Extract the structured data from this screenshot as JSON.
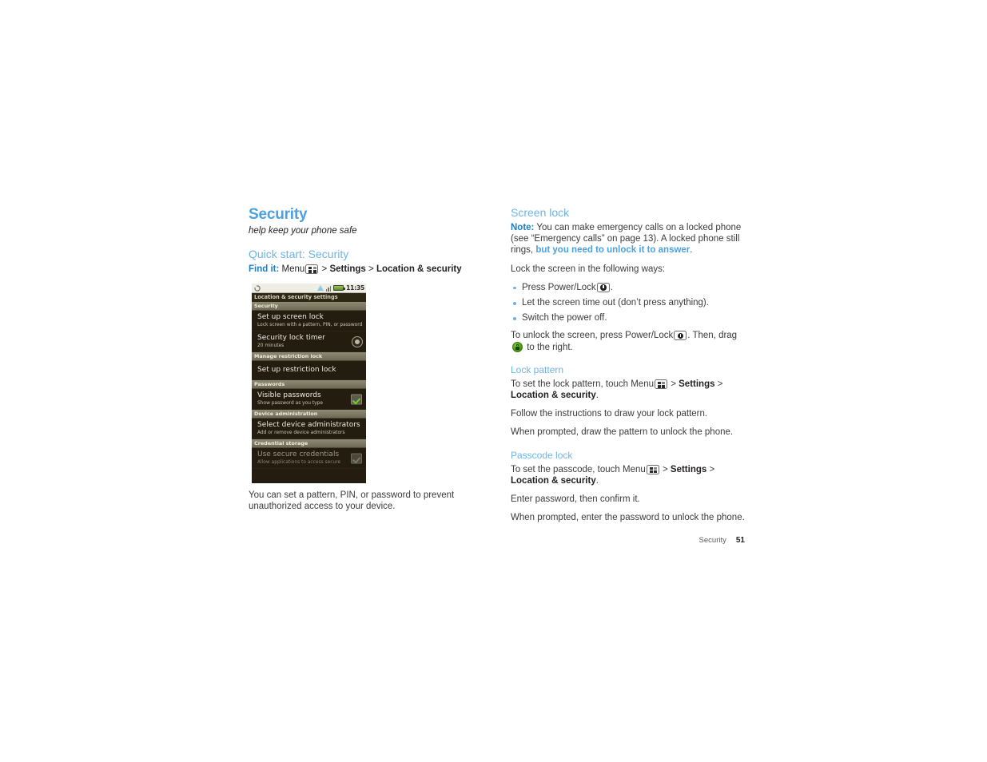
{
  "document": {
    "footer_section": "Security",
    "footer_page_number": "51"
  },
  "left_column": {
    "chapter_title": "Security",
    "chapter_subtitle": "help keep your phone safe",
    "section_heading": "Quick start: Security",
    "find_it": {
      "label": "Find it:",
      "part1": "Menu",
      "menu_icon": "menu-grid-icon",
      "sep1": ">",
      "settings": "Settings",
      "sep2": ">",
      "location_security": "Location & security"
    },
    "caption": "You can set a pattern, PIN, or password to prevent unauthorized access to your device."
  },
  "phone_screenshot": {
    "status_bar": {
      "sync_icon": "sync-icon",
      "warning_icon": "triangle-alert-icon",
      "signal_icon": "signal-bars-icon",
      "battery_icon": "battery-icon",
      "time": "11:35"
    },
    "title_bar": "Location & security settings",
    "groups": [
      {
        "category": "Security",
        "items": [
          {
            "title": "Set up screen lock",
            "subtitle": "Lock screen with a pattern, PIN, or password",
            "control": "none"
          },
          {
            "title": "Security lock timer",
            "subtitle": "20 minutes",
            "control": "timer-icon"
          }
        ]
      },
      {
        "category": "Manage restriction lock",
        "items": [
          {
            "title": "Set up restriction lock",
            "subtitle": "",
            "control": "none"
          }
        ]
      },
      {
        "category": "Passwords",
        "items": [
          {
            "title": "Visible passwords",
            "subtitle": "Show password as you type",
            "control": "checkbox-checked"
          }
        ]
      },
      {
        "category": "Device administration",
        "items": [
          {
            "title": "Select device administrators",
            "subtitle": "Add or remove device administrators",
            "control": "none"
          }
        ]
      },
      {
        "category": "Credential storage",
        "items": [
          {
            "title": "Use secure credentials",
            "subtitle": "Allow applications to access secure",
            "control": "checkbox-disabled"
          }
        ]
      }
    ]
  },
  "right_column": {
    "screen_lock": {
      "heading": "Screen lock",
      "note_label": "Note:",
      "note_text_1": "You can make emergency calls on a locked phone (see “Emergency calls” on page 13). A locked phone still rings,",
      "note_accent": "but you need to unlock it to answer",
      "note_end": ".",
      "intro": "Lock the screen in the following ways:",
      "bullets": [
        {
          "before": "Press Power/Lock",
          "icon": "power-lock-icon",
          "after": "."
        },
        {
          "before": "Let the screen time out (don’t press anything).",
          "icon": "",
          "after": ""
        },
        {
          "before": "Switch the power off.",
          "icon": "",
          "after": ""
        }
      ],
      "unlock_part1": "To unlock the screen, press Power/Lock",
      "unlock_icon": "power-lock-icon",
      "unlock_part2": ". Then, drag",
      "unlock_lock_icon": "green-lock-icon",
      "unlock_part3": "to the right."
    },
    "lock_pattern": {
      "heading": "Lock pattern",
      "step1_pre": "To set the lock pattern, touch Menu",
      "step1_icon": "menu-grid-icon",
      "step1_sep": ">",
      "step1_settings": "Settings",
      "step1_sep2": ">",
      "step1_location": "Location & security",
      "step1_end": ".",
      "step2": "Follow the instructions to draw your lock pattern.",
      "step3": "When prompted, draw the pattern to unlock the phone."
    },
    "passcode_lock": {
      "heading": "Passcode lock",
      "step1_pre": "To set the passcode, touch Menu",
      "step1_icon": "menu-grid-icon",
      "step1_sep": ">",
      "step1_settings": "Settings",
      "step1_sep2": ">",
      "step1_location": "Location & security",
      "step1_end": ".",
      "step2": "Enter password, then confirm it.",
      "step3": "When prompted, enter the password to unlock the phone."
    }
  },
  "colors": {
    "accent_blue": "#6cb5e8",
    "link_blue": "#1c7fc4",
    "title_blue": "#4da1e0",
    "body_text": "#3b3b3b",
    "phone_bg": "#231c0f"
  }
}
